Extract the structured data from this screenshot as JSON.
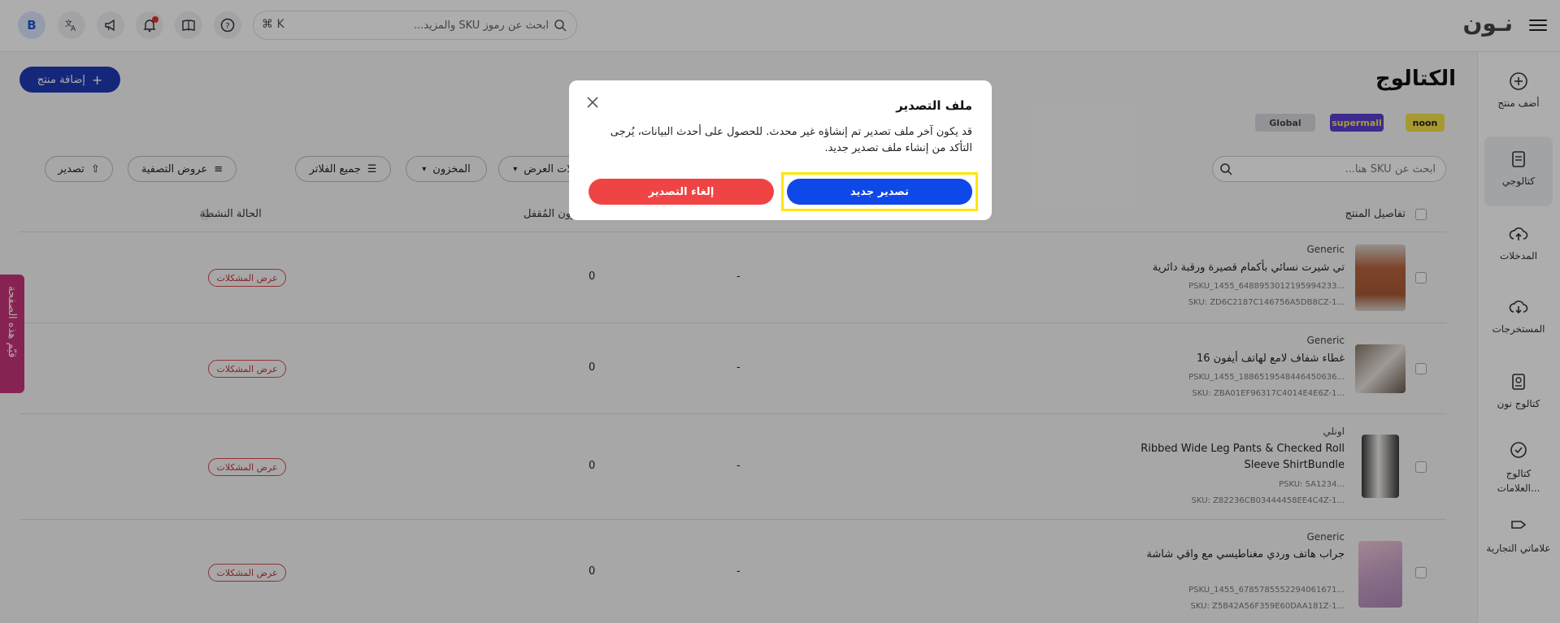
{
  "topbar": {
    "logo": "نـون",
    "search_placeholder": "ابحث عن رموز SKU والمزيد...",
    "shortcut": "⌘ K",
    "avatar_letter": "B"
  },
  "sidebar": {
    "items": [
      {
        "label": "أضف منتج",
        "icon": "plus-circle-icon"
      },
      {
        "label": "كتالوجي",
        "icon": "document-icon",
        "active": true
      },
      {
        "label": "المدخلات",
        "icon": "cloud-upload-icon"
      },
      {
        "label": "المستخرجات",
        "icon": "cloud-download-icon"
      },
      {
        "label": "كتالوج نون",
        "icon": "book-icon"
      },
      {
        "label": "كتالوج العلامات...",
        "icon": "badge-check-icon"
      },
      {
        "label": "علاماتي التجارية",
        "icon": "tag-icon"
      }
    ]
  },
  "main": {
    "title": "الكتالوج",
    "add_product": "إضافة منتج",
    "badges": {
      "noon": "noon",
      "supermall": "supermall",
      "global": "Global"
    },
    "sku_search_placeholder": "ابحث عن SKU هنا...",
    "filters": {
      "display_issues": "مشكلات العرض",
      "inventory": "المخزون",
      "all_filters": "جميع الفلاتر",
      "filter_views": "عروض التصفية",
      "export": "تصدير"
    },
    "columns": {
      "product_details": "تفاصيل المنتج",
      "locked_inventory": "المخزون المُقفل",
      "active_status": "الحالة النشطة"
    },
    "rows": [
      {
        "brand": "Generic",
        "name": "تي شيرت نسائي بأكمام قصيرة ورقبة دائرية",
        "psku": "PSKU_1455_6488953012195994233...",
        "sku": "SKU: ZD6C2187C146756A5DB8CZ-1...",
        "dash": "-",
        "locked": "0",
        "issues": "عرض المشكلات"
      },
      {
        "brand": "Generic",
        "name": "غطاء شفاف لامع لهاتف أيفون 16",
        "psku": "PSKU_1455_1886519548446450636...",
        "sku": "SKU: ZBA01EF96317C4014E4E6Z-1...",
        "dash": "-",
        "locked": "0",
        "issues": "عرض المشكلات"
      },
      {
        "brand": "اونلي",
        "name": "Ribbed Wide Leg Pants & Checked Roll Sleeve ShirtBundle",
        "psku": "PSKU: SA1234...",
        "sku": "SKU: Z82236CB03444458EE4C4Z-1...",
        "dash": "-",
        "locked": "0",
        "issues": "عرض المشكلات"
      },
      {
        "brand": "Generic",
        "name": "جراب هاتف وردي مغناطيسي مع واقي شاشة",
        "psku": "PSKU_1455_6785785552294061671...",
        "sku": "SKU: Z5B42A56F359E60DAA181Z-1...",
        "dash": "-",
        "locked": "0",
        "issues": "عرض المشكلات"
      }
    ]
  },
  "feedback_tab": "قيّم هذه الصفحة",
  "modal": {
    "title": "ملف التصدير",
    "body": "قد يكون آخر ملف تصدير تم إنشاؤه غير محدث. للحصول على أحدث البيانات، يُرجى التأكد من إنشاء ملف تصدير جديد.",
    "primary": "تصدير جديد",
    "cancel": "إلغاء التصدير"
  },
  "colors": {
    "primary": "#0e48e8",
    "danger": "#f04444",
    "highlight": "#ffe600"
  }
}
